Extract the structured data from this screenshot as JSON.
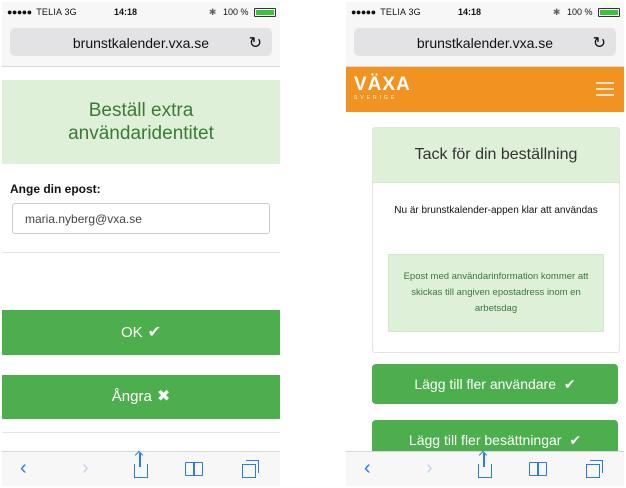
{
  "status_bar": {
    "carrier": "TELIA",
    "network": "3G",
    "time": "14:18",
    "battery": "100 %"
  },
  "browser": {
    "url": "brunstkalender.vxa.se",
    "reload_icon": "reload-icon"
  },
  "order_screen": {
    "title": "Beställ extra användaridentitet",
    "email_label": "Ange din epost:",
    "email_value": "maria.nyberg@vxa.se",
    "ok_label": "OK",
    "cancel_label": "Ångra"
  },
  "confirmation_screen": {
    "logo_text": "VÄXA",
    "logo_subtext": "SVERIGE",
    "heading": "Tack för din beställning",
    "message": "Nu är brunstkalender-appen klar att användas",
    "info": "Epost med användarinformation kommer att skickas till angiven epostadress inom en arbetsdag",
    "add_users_label": "Lägg till fler användare",
    "add_crews_label": "Lägg till fler besättningar"
  },
  "colors": {
    "brand_orange": "#f29321",
    "success_green": "#4cae4c",
    "panel_green": "#dff0d8",
    "link_blue": "#2a7be4"
  }
}
